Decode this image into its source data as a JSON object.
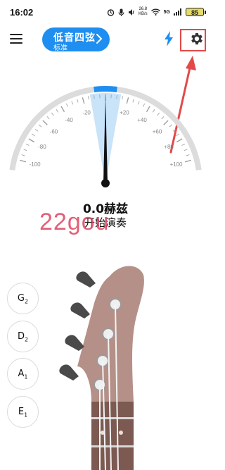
{
  "status_bar": {
    "time": "16:02",
    "net_speed": "26.8",
    "net_unit": "KB/s",
    "signal_label": "5G",
    "battery": "85"
  },
  "header": {
    "menu_icon": "hamburger-menu-icon",
    "tuning": {
      "name": "低音四弦",
      "subtitle": "标准"
    },
    "flash_icon": "lightning-bolt-icon",
    "settings_icon": "gear-icon"
  },
  "gauge": {
    "needle_value": 0,
    "ticks_left": [
      "-20",
      "-40",
      "-60",
      "-80",
      "-100"
    ],
    "ticks_right": [
      "+20",
      "+40",
      "+60",
      "+80",
      "+100"
    ],
    "accent_color": "#1e8ef0"
  },
  "readout": {
    "frequency": "0.0赫兹",
    "hint": "开始演奏"
  },
  "watermark": "22gou",
  "strings": [
    {
      "note": "G",
      "octave": "2"
    },
    {
      "note": "D",
      "octave": "2"
    },
    {
      "note": "A",
      "octave": "1"
    },
    {
      "note": "E",
      "octave": "1"
    }
  ],
  "colors": {
    "accent": "#1e8ef0",
    "annotation": "#e24a4a",
    "headstock": "#b49088",
    "peg": "#4a4a4a"
  }
}
